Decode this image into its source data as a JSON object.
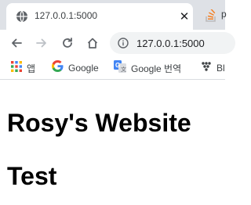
{
  "browser": {
    "active_tab": {
      "title": "127.0.0.1:5000",
      "favicon": "globe-icon",
      "close_glyph": "✕"
    },
    "inactive_tab": {
      "title": "p",
      "favicon": "stackoverflow-icon"
    },
    "toolbar": {
      "back_icon": "back-arrow-icon",
      "forward_icon": "forward-arrow-icon",
      "reload_icon": "reload-icon",
      "home_icon": "home-icon",
      "url": "127.0.0.1:5000",
      "security_icon": "info-icon"
    },
    "bookmarks": [
      {
        "label": "앱",
        "icon": "apps-grid-icon"
      },
      {
        "label": "Google",
        "icon": "google-icon"
      },
      {
        "label": "Google 번역",
        "icon": "google-translate-icon"
      },
      {
        "label": "Bl",
        "icon": "dots-icon"
      }
    ]
  },
  "page": {
    "heading_1": "Rosy's Website",
    "heading_2": "Test"
  },
  "colors": {
    "tabstrip_bg": "#dee1e6",
    "omnibox_bg": "#f1f3f4",
    "text": "#202124",
    "icon": "#5f6368"
  }
}
